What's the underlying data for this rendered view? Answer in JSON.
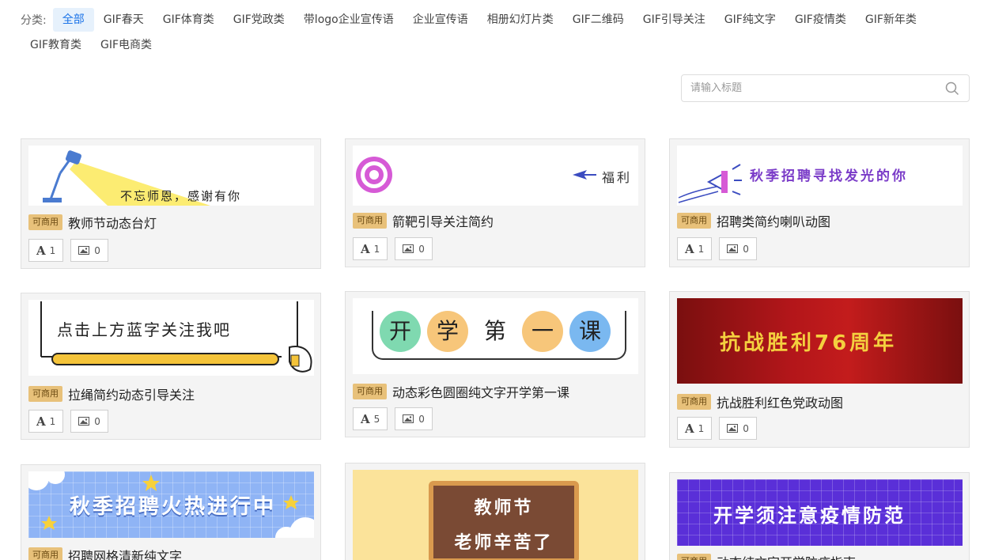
{
  "categories": {
    "label": "分类:",
    "items": [
      "全部",
      "GIF春天",
      "GIF体育类",
      "GIF党政类",
      "带logo企业宣传语",
      "企业宣传语",
      "相册幻灯片类",
      "GIF二维码",
      "GIF引导关注",
      "GIF纯文字",
      "GIF疫情类",
      "GIF新年类",
      "GIF教育类",
      "GIF电商类"
    ],
    "active": "全部"
  },
  "search": {
    "placeholder": "请输入标题"
  },
  "colors": {
    "accent": "#1a73e8",
    "tag_bg": "#e8c17a",
    "card_bg": "#f4f4f4"
  },
  "cards": [
    {
      "tag": "可商用",
      "title": "教师节动态台灯",
      "font_count": "1",
      "image_count": "0",
      "thumb_text": "不忘师恩，感谢有你"
    },
    {
      "tag": "可商用",
      "title": "箭靶引导关注简约",
      "font_count": "1",
      "image_count": "0",
      "thumb_text": "福利"
    },
    {
      "tag": "可商用",
      "title": "招聘类简约喇叭动图",
      "font_count": "1",
      "image_count": "0",
      "thumb_text": "秋季招聘寻找发光的你"
    },
    {
      "tag": "可商用",
      "title": "拉绳简约动态引导关注",
      "font_count": "1",
      "image_count": "0",
      "thumb_text": "点击上方蓝字关注我吧"
    },
    {
      "tag": "可商用",
      "title": "动态彩色圆圈纯文字开学第一课",
      "font_count": "5",
      "image_count": "0",
      "thumb_chars": [
        "开",
        "学",
        "第",
        "一",
        "课"
      ]
    },
    {
      "tag": "可商用",
      "title": "抗战胜利红色党政动图",
      "font_count": "1",
      "image_count": "0",
      "thumb_text": "抗战胜利76周年"
    },
    {
      "tag": "可商用",
      "title": "招聘网格清新纯文字",
      "thumb_text": "秋季招聘火热进行中"
    },
    {
      "tag": "",
      "title": "",
      "thumb_text": "教师节",
      "thumb_text2": "老师辛苦了"
    },
    {
      "tag": "可商用",
      "title": "动态纯文字开学防疫指南",
      "thumb_text": "开学须注意疫情防范"
    }
  ]
}
